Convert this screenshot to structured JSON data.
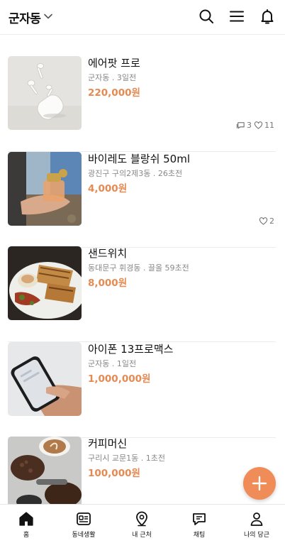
{
  "header": {
    "location": "군자동",
    "icons": [
      "chevron-down-icon",
      "search-icon",
      "menu-icon",
      "bell-icon"
    ]
  },
  "items": [
    {
      "title": "에어팟 프로",
      "meta": "군자동 . 3일전",
      "price": "220,000원",
      "chats": "3",
      "likes": "11",
      "image": "airpods-photo"
    },
    {
      "title": "바이레도 블랑쉬 50ml",
      "meta": "광진구 구의2제3동 . 26초전",
      "price": "4,000원",
      "likes": "2",
      "image": "perfume-photo"
    },
    {
      "title": "샌드위치",
      "meta": "동대문구 휘경동 . 끌올 59초전",
      "price": "8,000원",
      "image": "sandwich-photo"
    },
    {
      "title": "아이폰 13프로맥스",
      "meta": "군자동 . 1일전",
      "price": "1,000,000원",
      "image": "phone-photo"
    },
    {
      "title": "커피머신",
      "meta": "구리시 교문1동 . 1초전",
      "price": "100,000원",
      "image": "coffee-photo"
    }
  ],
  "fab": {
    "icon": "plus-icon"
  },
  "nav": [
    {
      "label": "홈",
      "icon": "home-icon",
      "active": true
    },
    {
      "label": "동네생활",
      "icon": "newspaper-icon"
    },
    {
      "label": "내 근처",
      "icon": "location-pin-icon"
    },
    {
      "label": "채팅",
      "icon": "chat-icon"
    },
    {
      "label": "나의 당근",
      "icon": "person-icon"
    }
  ],
  "colors": {
    "accent": "#e58a52",
    "fab": "#ef8c58",
    "meta": "#888888",
    "divider": "#ececec"
  }
}
